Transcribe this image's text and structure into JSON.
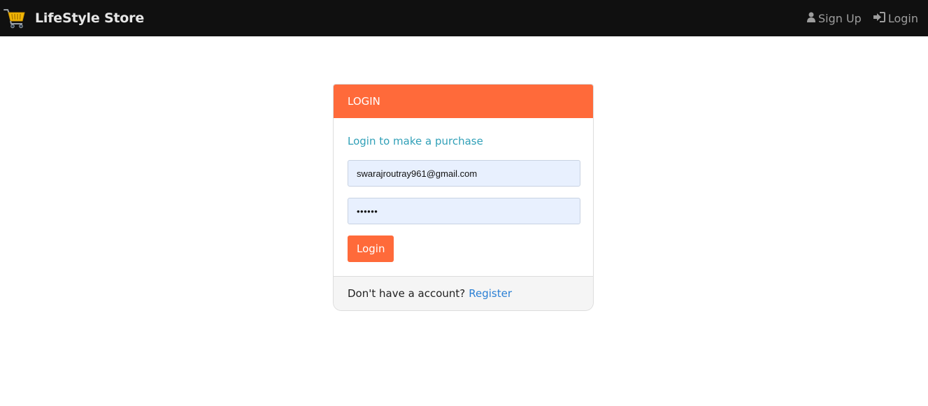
{
  "navbar": {
    "brand_name": "LifeStyle Store",
    "brand_icon": "shopping-cart-icon",
    "links": [
      {
        "label": "Sign Up",
        "icon": "user-icon"
      },
      {
        "label": "Login",
        "icon": "sign-in-icon"
      }
    ]
  },
  "login_card": {
    "header_title": "LOGIN",
    "subtitle": "Login to make a purchase",
    "email_value": "swarajroutray961@gmail.com",
    "password_value": "••••••",
    "submit_label": "Login",
    "footer_text": "Don't have a account?",
    "footer_link": "Register"
  },
  "colors": {
    "navbar_bg": "#101010",
    "accent": "#ff6a3a",
    "subtitle": "#31a0b8",
    "link": "#2a7fd4",
    "input_bg": "#e8f0fe"
  }
}
